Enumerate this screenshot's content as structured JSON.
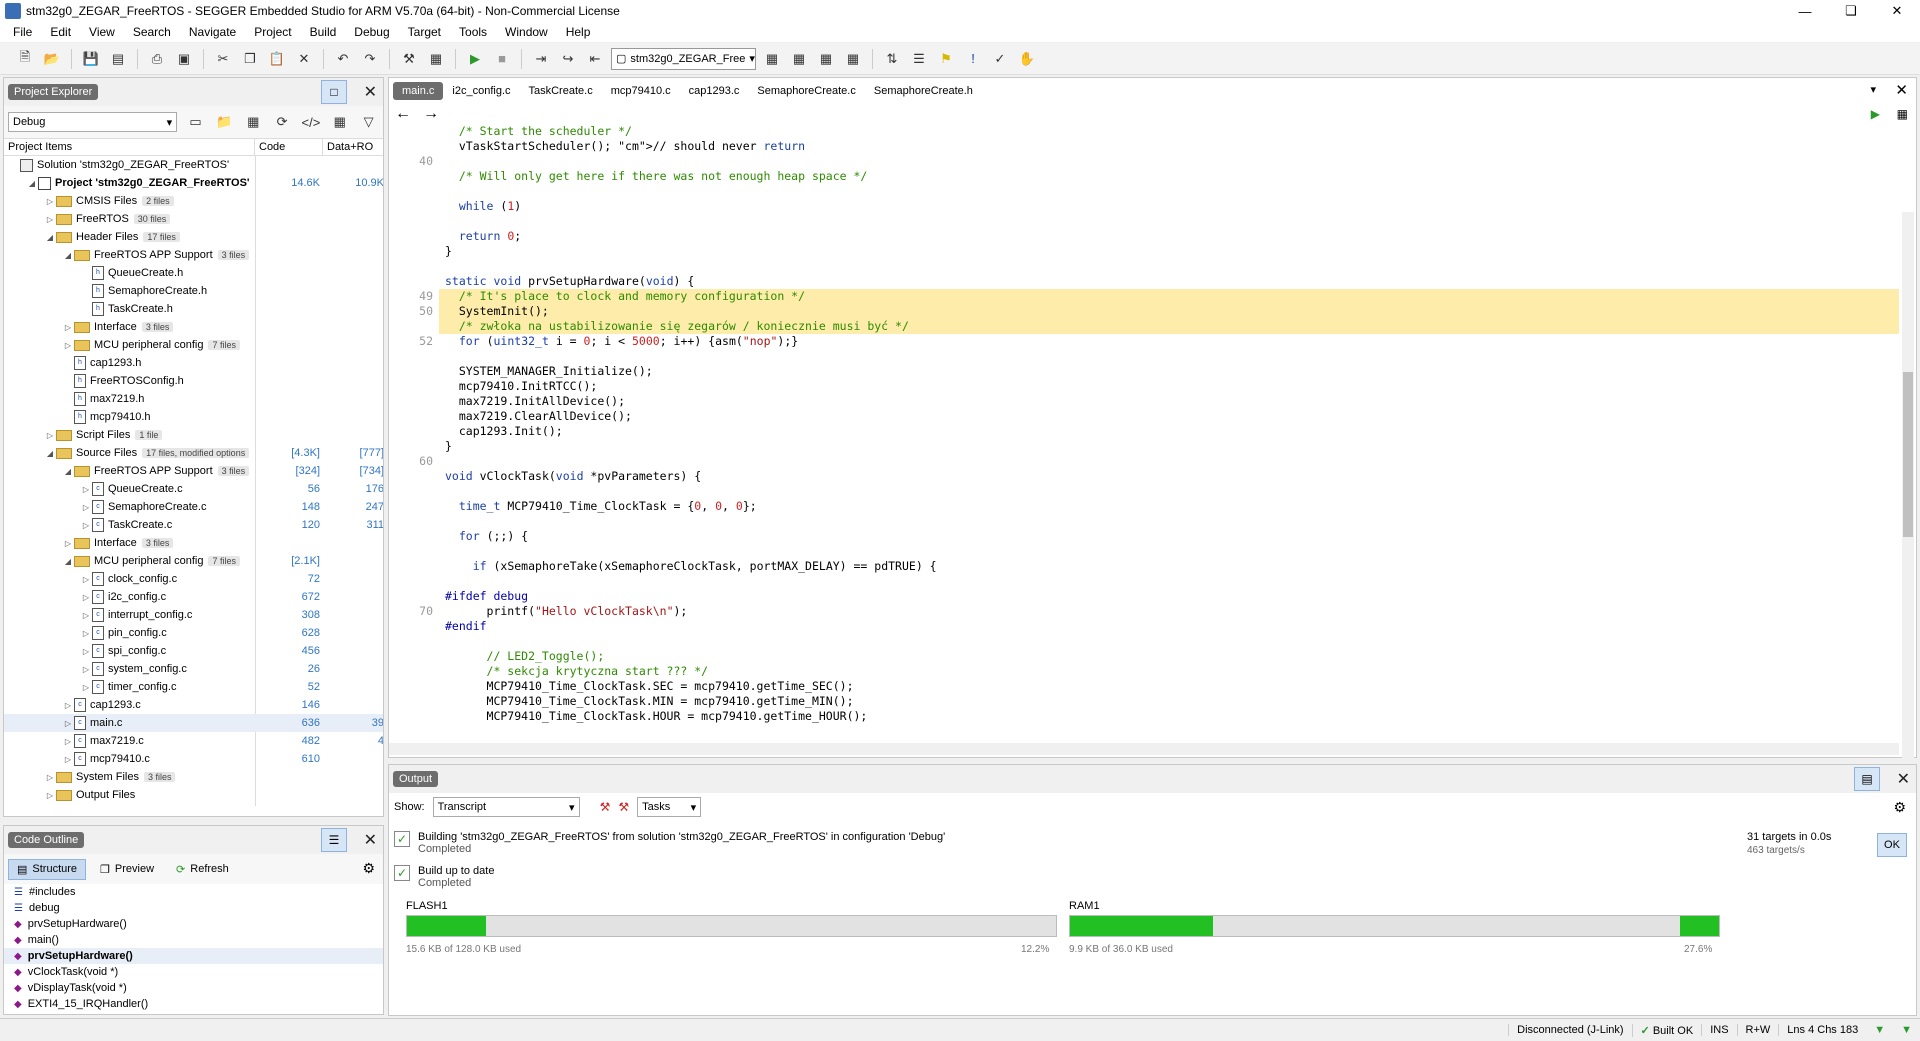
{
  "window": {
    "title": "stm32g0_ZEGAR_FreeRTOS - SEGGER Embedded Studio for ARM V5.70a (64-bit) - Non-Commercial License"
  },
  "menu": [
    "File",
    "Edit",
    "View",
    "Search",
    "Navigate",
    "Project",
    "Build",
    "Debug",
    "Target",
    "Tools",
    "Window",
    "Help"
  ],
  "toolbar": {
    "target_select": "stm32g0_ZEGAR_Free"
  },
  "project_explorer": {
    "title": "Project Explorer",
    "config": "Debug",
    "col_items": "Project Items",
    "col_code": "Code",
    "col_ro": "Data+RO",
    "rows": [
      {
        "label": "Solution 'stm32g0_ZEGAR_FreeRTOS'",
        "indent": 0,
        "icon": "solution",
        "exp": "",
        "code": "",
        "ro": "",
        "badge": ""
      },
      {
        "label": "Project 'stm32g0_ZEGAR_FreeRTOS'",
        "indent": 1,
        "icon": "project",
        "exp": "◢",
        "code": "14.6K",
        "ro": "10.9K",
        "badge": "",
        "bold": true
      },
      {
        "label": "CMSIS Files",
        "indent": 2,
        "icon": "folder",
        "exp": "▷",
        "code": "",
        "ro": "",
        "badge": "2 files"
      },
      {
        "label": "FreeRTOS",
        "indent": 2,
        "icon": "folder",
        "exp": "▷",
        "code": "",
        "ro": "",
        "badge": "30 files"
      },
      {
        "label": "Header Files",
        "indent": 2,
        "icon": "folder",
        "exp": "◢",
        "code": "",
        "ro": "",
        "badge": "17 files"
      },
      {
        "label": "FreeRTOS APP Support",
        "indent": 3,
        "icon": "folder",
        "exp": "◢",
        "code": "",
        "ro": "",
        "badge": "3 files"
      },
      {
        "label": "QueueCreate.h",
        "indent": 4,
        "icon": "h",
        "exp": "",
        "code": "",
        "ro": "",
        "badge": ""
      },
      {
        "label": "SemaphoreCreate.h",
        "indent": 4,
        "icon": "h",
        "exp": "",
        "code": "",
        "ro": "",
        "badge": ""
      },
      {
        "label": "TaskCreate.h",
        "indent": 4,
        "icon": "h",
        "exp": "",
        "code": "",
        "ro": "",
        "badge": ""
      },
      {
        "label": "Interface",
        "indent": 3,
        "icon": "folder",
        "exp": "▷",
        "code": "",
        "ro": "",
        "badge": "3 files"
      },
      {
        "label": "MCU peripheral config",
        "indent": 3,
        "icon": "folder",
        "exp": "▷",
        "code": "",
        "ro": "",
        "badge": "7 files"
      },
      {
        "label": "cap1293.h",
        "indent": 3,
        "icon": "h",
        "exp": "",
        "code": "",
        "ro": "",
        "badge": ""
      },
      {
        "label": "FreeRTOSConfig.h",
        "indent": 3,
        "icon": "h",
        "exp": "",
        "code": "",
        "ro": "",
        "badge": ""
      },
      {
        "label": "max7219.h",
        "indent": 3,
        "icon": "h",
        "exp": "",
        "code": "",
        "ro": "",
        "badge": ""
      },
      {
        "label": "mcp79410.h",
        "indent": 3,
        "icon": "h",
        "exp": "",
        "code": "",
        "ro": "",
        "badge": ""
      },
      {
        "label": "Script Files",
        "indent": 2,
        "icon": "folder",
        "exp": "▷",
        "code": "",
        "ro": "",
        "badge": "1 file"
      },
      {
        "label": "Source Files",
        "indent": 2,
        "icon": "folder",
        "exp": "◢",
        "code": "[4.3K]",
        "ro": "[777]",
        "badge": "17 files, modified options"
      },
      {
        "label": "FreeRTOS APP Support",
        "indent": 3,
        "icon": "folder",
        "exp": "◢",
        "code": "[324]",
        "ro": "[734]",
        "badge": "3 files"
      },
      {
        "label": "QueueCreate.c",
        "indent": 4,
        "icon": "c",
        "exp": "▷",
        "code": "56",
        "ro": "176",
        "badge": ""
      },
      {
        "label": "SemaphoreCreate.c",
        "indent": 4,
        "icon": "c",
        "exp": "▷",
        "code": "148",
        "ro": "247",
        "badge": ""
      },
      {
        "label": "TaskCreate.c",
        "indent": 4,
        "icon": "c",
        "exp": "▷",
        "code": "120",
        "ro": "311",
        "badge": ""
      },
      {
        "label": "Interface",
        "indent": 3,
        "icon": "folder",
        "exp": "▷",
        "code": "",
        "ro": "",
        "badge": "3 files"
      },
      {
        "label": "MCU peripheral config",
        "indent": 3,
        "icon": "folder",
        "exp": "◢",
        "code": "[2.1K]",
        "ro": "",
        "badge": "7 files"
      },
      {
        "label": "clock_config.c",
        "indent": 4,
        "icon": "c",
        "exp": "▷",
        "code": "72",
        "ro": "",
        "badge": ""
      },
      {
        "label": "i2c_config.c",
        "indent": 4,
        "icon": "c",
        "exp": "▷",
        "code": "672",
        "ro": "",
        "badge": ""
      },
      {
        "label": "interrupt_config.c",
        "indent": 4,
        "icon": "c",
        "exp": "▷",
        "code": "308",
        "ro": "",
        "badge": ""
      },
      {
        "label": "pin_config.c",
        "indent": 4,
        "icon": "c",
        "exp": "▷",
        "code": "628",
        "ro": "",
        "badge": ""
      },
      {
        "label": "spi_config.c",
        "indent": 4,
        "icon": "c",
        "exp": "▷",
        "code": "456",
        "ro": "",
        "badge": ""
      },
      {
        "label": "system_config.c",
        "indent": 4,
        "icon": "c",
        "exp": "▷",
        "code": "26",
        "ro": "",
        "badge": ""
      },
      {
        "label": "timer_config.c",
        "indent": 4,
        "icon": "c",
        "exp": "▷",
        "code": "52",
        "ro": "",
        "badge": ""
      },
      {
        "label": "cap1293.c",
        "indent": 3,
        "icon": "c",
        "exp": "▷",
        "code": "146",
        "ro": "",
        "badge": ""
      },
      {
        "label": "main.c",
        "indent": 3,
        "icon": "c",
        "exp": "▷",
        "code": "636",
        "ro": "39",
        "badge": "",
        "selected": true
      },
      {
        "label": "max7219.c",
        "indent": 3,
        "icon": "c",
        "exp": "▷",
        "code": "482",
        "ro": "4",
        "badge": ""
      },
      {
        "label": "mcp79410.c",
        "indent": 3,
        "icon": "c",
        "exp": "▷",
        "code": "610",
        "ro": "",
        "badge": ""
      },
      {
        "label": "System Files",
        "indent": 2,
        "icon": "folder",
        "exp": "▷",
        "code": "",
        "ro": "",
        "badge": "3 files"
      },
      {
        "label": "Output Files",
        "indent": 2,
        "icon": "folder",
        "exp": "▷",
        "code": "",
        "ro": "",
        "badge": ""
      }
    ]
  },
  "code_outline": {
    "title": "Code Outline",
    "tabs": [
      "Structure",
      "Preview",
      "Refresh"
    ],
    "items": [
      {
        "label": "#includes",
        "kind": "group"
      },
      {
        "label": "debug",
        "kind": "group"
      },
      {
        "label": "prvSetupHardware()",
        "kind": "fn"
      },
      {
        "label": "main()",
        "kind": "fn"
      },
      {
        "label": "prvSetupHardware()",
        "kind": "fn",
        "bold": true
      },
      {
        "label": "vClockTask(void *)",
        "kind": "fn"
      },
      {
        "label": "vDisplayTask(void *)",
        "kind": "fn"
      },
      {
        "label": "EXTI4_15_IRQHandler()",
        "kind": "fn"
      }
    ]
  },
  "editor": {
    "tabs": [
      "main.c",
      "i2c_config.c",
      "TaskCreate.c",
      "mcp79410.c",
      "cap1293.c",
      "SemaphoreCreate.c",
      "SemaphoreCreate.h"
    ],
    "lines": [
      {
        "n": "",
        "t": "  /* Start the scheduler */",
        "c": "cm"
      },
      {
        "n": "",
        "t": "  vTaskStartScheduler(); // should never return",
        "c": "mix1"
      },
      {
        "n": "40",
        "t": "",
        "c": ""
      },
      {
        "n": "",
        "t": "  /* Will only get here if there was not enough heap space */",
        "c": "cm"
      },
      {
        "n": "",
        "t": "",
        "c": ""
      },
      {
        "n": "",
        "t": "  while (1)",
        "c": "while"
      },
      {
        "n": "",
        "t": "",
        "c": ""
      },
      {
        "n": "",
        "t": "  return 0;",
        "c": "ret"
      },
      {
        "n": "",
        "t": "}",
        "c": ""
      },
      {
        "n": "",
        "t": "",
        "c": ""
      },
      {
        "n": "",
        "t": "static void prvSetupHardware(void) {",
        "c": "sig"
      },
      {
        "n": "49",
        "t": "  /* It's place to clock and memory configuration */",
        "c": "cm",
        "hl": true
      },
      {
        "n": "50",
        "t": "  SystemInit();",
        "c": "",
        "hl": true
      },
      {
        "n": "",
        "t": "  /* zwłoka na ustabilizowanie się zegarów / koniecznie musi być */",
        "c": "cm",
        "hl": true
      },
      {
        "n": "52",
        "t": "  for (uint32_t i = 0; i < 5000; i++) {asm(\"nop\");}",
        "c": "for"
      },
      {
        "n": "",
        "t": "",
        "c": ""
      },
      {
        "n": "",
        "t": "  SYSTEM_MANAGER_Initialize();",
        "c": ""
      },
      {
        "n": "",
        "t": "  mcp79410.InitRTCC();",
        "c": ""
      },
      {
        "n": "",
        "t": "  max7219.InitAllDevice();",
        "c": ""
      },
      {
        "n": "",
        "t": "  max7219.ClearAllDevice();",
        "c": ""
      },
      {
        "n": "",
        "t": "  cap1293.Init();",
        "c": ""
      },
      {
        "n": "",
        "t": "}",
        "c": ""
      },
      {
        "n": "60",
        "t": "",
        "c": ""
      },
      {
        "n": "",
        "t": "void vClockTask(void *pvParameters) {",
        "c": "sig"
      },
      {
        "n": "",
        "t": "",
        "c": ""
      },
      {
        "n": "",
        "t": "  time_t MCP79410_Time_ClockTask = {0, 0, 0};",
        "c": ""
      },
      {
        "n": "",
        "t": "",
        "c": ""
      },
      {
        "n": "",
        "t": "  for (;;) {",
        "c": "kwl"
      },
      {
        "n": "",
        "t": "",
        "c": ""
      },
      {
        "n": "",
        "t": "    if (xSemaphoreTake(xSemaphoreClockTask, portMAX_DELAY) == pdTRUE) {",
        "c": "kwl"
      },
      {
        "n": "",
        "t": "",
        "c": ""
      },
      {
        "n": "",
        "t": "#ifdef debug",
        "c": "pp"
      },
      {
        "n": "70",
        "t": "      printf(\"Hello vClockTask\\n\");",
        "c": "printf"
      },
      {
        "n": "",
        "t": "#endif",
        "c": "pp"
      },
      {
        "n": "",
        "t": "",
        "c": ""
      },
      {
        "n": "",
        "t": "      // LED2_Toggle();",
        "c": "cm"
      },
      {
        "n": "",
        "t": "      /* sekcja krytyczna start ??? */",
        "c": "cm"
      },
      {
        "n": "",
        "t": "      MCP79410_Time_ClockTask.SEC = mcp79410.getTime_SEC();",
        "c": ""
      },
      {
        "n": "",
        "t": "      MCP79410_Time_ClockTask.MIN = mcp79410.getTime_MIN();",
        "c": ""
      },
      {
        "n": "",
        "t": "      MCP79410_Time_ClockTask.HOUR = mcp79410.getTime_HOUR();",
        "c": ""
      }
    ]
  },
  "output": {
    "title": "Output",
    "show_label": "Show:",
    "show_value": "Transcript",
    "tasks_value": "Tasks",
    "entries": [
      {
        "title": "Building 'stm32g0_ZEGAR_FreeRTOS' from solution 'stm32g0_ZEGAR_FreeRTOS' in configuration 'Debug'",
        "sub": "Completed"
      },
      {
        "title": "Build up to date",
        "sub": "Completed"
      }
    ],
    "targets": "31 targets in 0.0s",
    "rate": "463 targets/s",
    "ok_label": "OK",
    "flash": {
      "label": "FLASH1",
      "used": "15.6 KB of 128.0 KB used",
      "pct": "12.2%",
      "fill": 0.122
    },
    "ram": {
      "label": "RAM1",
      "used": "9.9 KB of 36.0 KB used",
      "pct": "27.6%",
      "fill_front": 0.22,
      "fill_back": 0.06
    }
  },
  "status": {
    "conn": "Disconnected (J-Link)",
    "build": "Built OK",
    "ins": "INS",
    "rw": "R+W",
    "pos": "Lns 4 Chs 183"
  },
  "colors": {
    "accent_green": "#22c022",
    "highlight": "#fdecaa",
    "comment": "#2e8b00"
  }
}
